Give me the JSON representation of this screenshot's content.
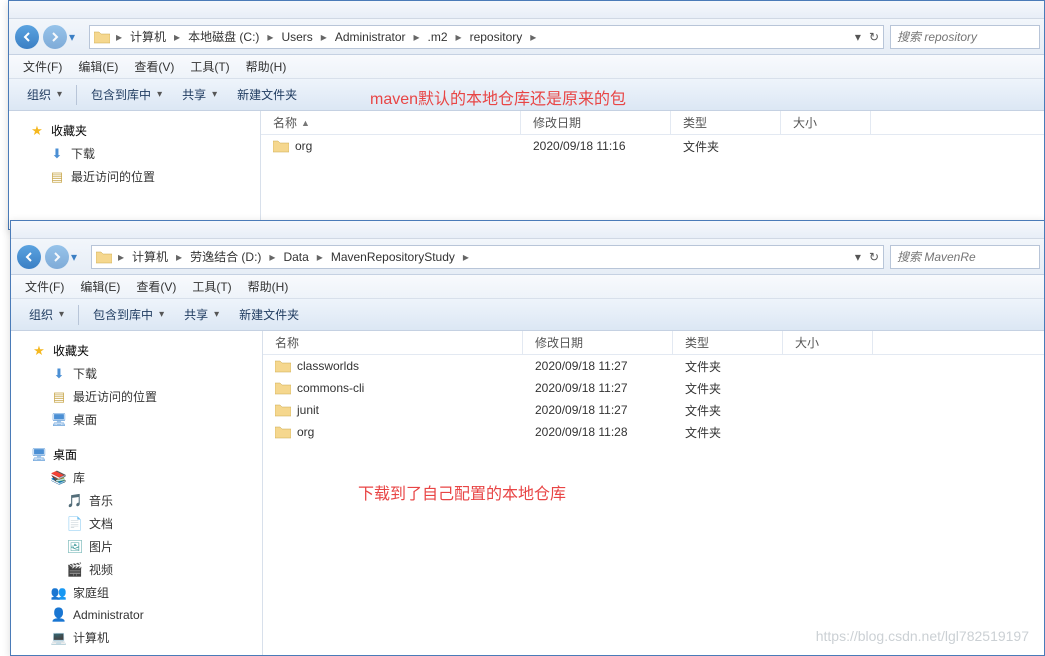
{
  "window1": {
    "breadcrumb": [
      "计算机",
      "本地磁盘 (C:)",
      "Users",
      "Administrator",
      ".m2",
      "repository"
    ],
    "search_placeholder": "搜索 repository",
    "menubar": [
      "文件(F)",
      "编辑(E)",
      "查看(V)",
      "工具(T)",
      "帮助(H)"
    ],
    "toolbar": {
      "organize": "组织",
      "include": "包含到库中",
      "share": "共享",
      "newfolder": "新建文件夹"
    },
    "sidebar": {
      "favorites": "收藏夹",
      "items": [
        {
          "icon": "download",
          "label": "下载"
        },
        {
          "icon": "recent",
          "label": "最近访问的位置"
        }
      ]
    },
    "columns": {
      "name": "名称",
      "date": "修改日期",
      "type": "类型",
      "size": "大小"
    },
    "files": [
      {
        "name": "org",
        "date": "2020/09/18 11:16",
        "type": "文件夹"
      }
    ]
  },
  "window2": {
    "breadcrumb": [
      "计算机",
      "劳逸结合 (D:)",
      "Data",
      "MavenRepositoryStudy"
    ],
    "search_placeholder": "搜索 MavenRe",
    "menubar": [
      "文件(F)",
      "编辑(E)",
      "查看(V)",
      "工具(T)",
      "帮助(H)"
    ],
    "toolbar": {
      "organize": "组织",
      "include": "包含到库中",
      "share": "共享",
      "newfolder": "新建文件夹"
    },
    "sidebar": {
      "favorites": "收藏夹",
      "fav_items": [
        {
          "icon": "download",
          "label": "下载"
        },
        {
          "icon": "recent",
          "label": "最近访问的位置"
        },
        {
          "icon": "desktop",
          "label": "桌面"
        }
      ],
      "desktop": "桌面",
      "desktop_items": [
        {
          "icon": "library",
          "label": "库"
        },
        {
          "icon": "music",
          "label": "音乐"
        },
        {
          "icon": "docs",
          "label": "文档"
        },
        {
          "icon": "pics",
          "label": "图片"
        },
        {
          "icon": "video",
          "label": "视频"
        },
        {
          "icon": "homegroup",
          "label": "家庭组"
        },
        {
          "icon": "user",
          "label": "Administrator"
        },
        {
          "icon": "computer",
          "label": "计算机"
        }
      ]
    },
    "columns": {
      "name": "名称",
      "date": "修改日期",
      "type": "类型",
      "size": "大小"
    },
    "files": [
      {
        "name": "classworlds",
        "date": "2020/09/18 11:27",
        "type": "文件夹"
      },
      {
        "name": "commons-cli",
        "date": "2020/09/18 11:27",
        "type": "文件夹"
      },
      {
        "name": "junit",
        "date": "2020/09/18 11:27",
        "type": "文件夹"
      },
      {
        "name": "org",
        "date": "2020/09/18 11:28",
        "type": "文件夹"
      }
    ]
  },
  "annotations": {
    "top": "maven默认的本地仓库还是原来的包",
    "bottom": "下载到了自己配置的本地仓库"
  },
  "watermark": "https://blog.csdn.net/lgl782519197",
  "icons": {
    "download": "⬇",
    "recent": "📁",
    "desktop": "🖥",
    "library": "📚",
    "music": "🎵",
    "docs": "📄",
    "pics": "🖼",
    "video": "🎬",
    "homegroup": "👥",
    "user": "👤",
    "computer": "💻"
  }
}
